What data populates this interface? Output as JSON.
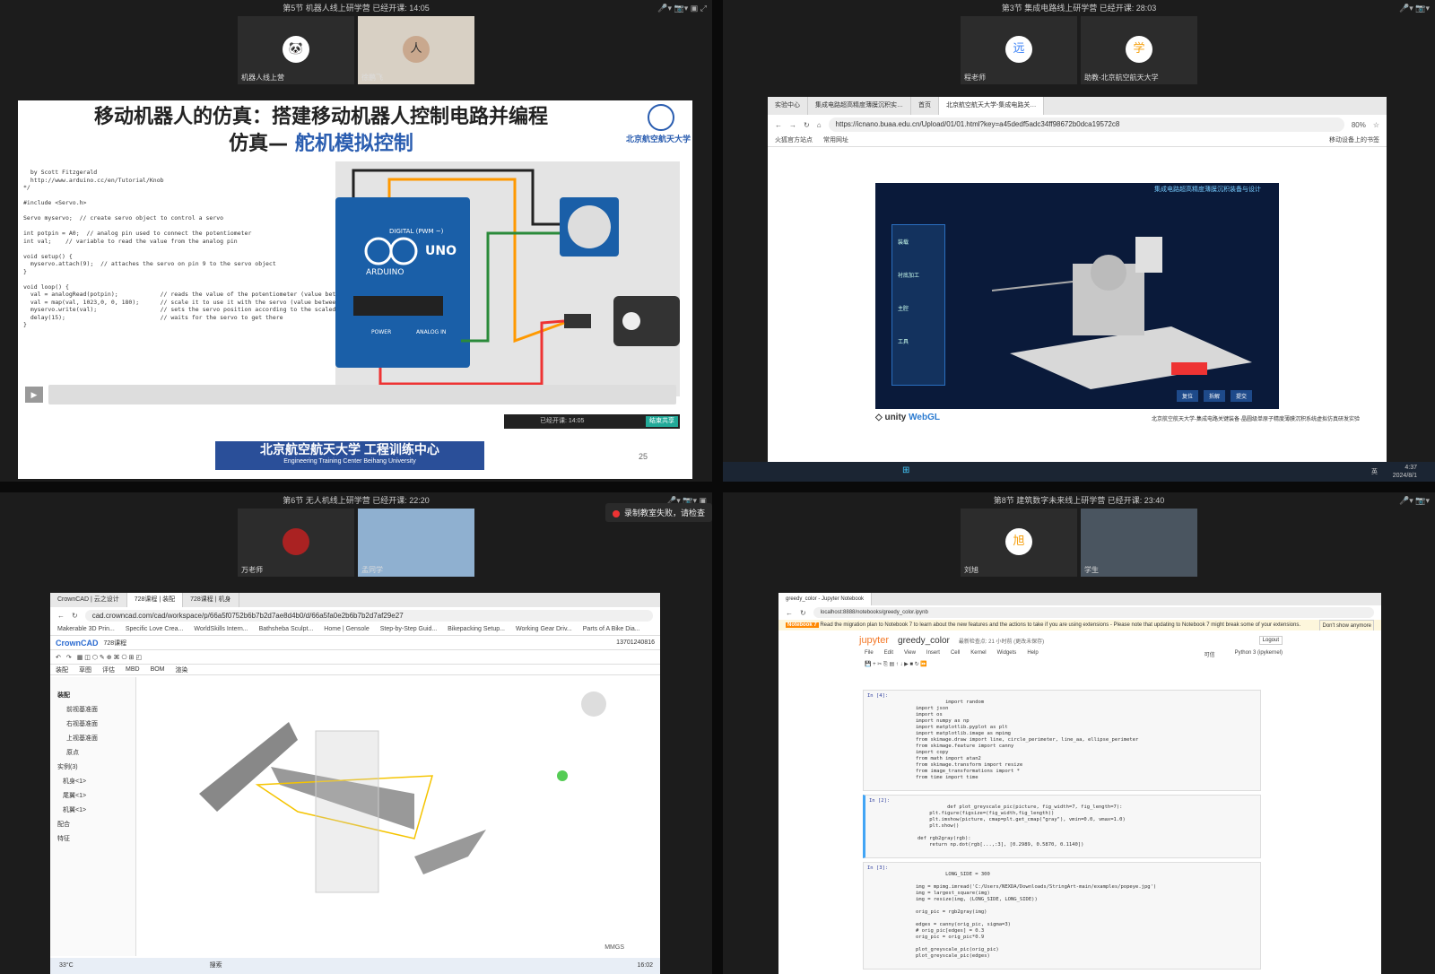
{
  "q1": {
    "topbar": "第5节 机器人线上研学营   已经开课: 14:05",
    "participants": [
      {
        "name": "机器人线上营",
        "avatar": "🐼"
      },
      {
        "name": "徐鹏飞",
        "avatar": "人"
      }
    ],
    "slide": {
      "title": "移动机器人的仿真：搭建移动机器人控制电路并编程",
      "subtitle_prefix": "仿真— ",
      "subtitle": "舵机模拟控制",
      "logo_text": "北京航空航天大学",
      "code": "  by Scott Fitzgerald\n  http://www.arduino.cc/en/Tutorial/Knob\n*/\n\n#include <Servo.h>\n\nServo myservo;  // create servo object to control a servo\n\nint potpin = A0;  // analog pin used to connect the potentiometer\nint val;    // variable to read the value from the analog pin\n\nvoid setup() {\n  myservo.attach(9);  // attaches the servo on pin 9 to the servo object\n}\n\nvoid loop() {\n  val = analogRead(potpin);            // reads the value of the potentiometer (value between 0 and\n  val = map(val, 1023,0, 0, 180);      // scale it to use it with the servo (value between 0 and 18\n  myservo.write(val);                  // sets the servo position according to the scaled value\n  delay(15);                           // waits for the servo to get there\n}",
      "board_label": "UNO",
      "board_brand": "ARDUINO",
      "digital_label": "DIGITAL (PWM ~)",
      "power_label": "POWER",
      "analog_label": "ANALOG IN",
      "footer_cn": "北京航空航天大学 工程训练中心",
      "footer_en": "Engineering Training Center Beihang University",
      "page": "25",
      "meet_time": "已经开课: 14:05",
      "meet_share": "结束共享"
    }
  },
  "q2": {
    "topbar": "第3节 集成电路线上研学营   已经开课: 28:03",
    "participants": [
      {
        "name": "程老师",
        "avatar": "远",
        "color": "#3b82f6"
      },
      {
        "name": "助教-北京航空航天大学",
        "avatar": "学",
        "color": "#f59e0b"
      }
    ],
    "tabs": [
      "实验中心",
      "集成电路超高精度薄膜沉积实…",
      "首页",
      "北京航空航天大学-集成电路关…"
    ],
    "url": "https://icnano.buaa.edu.cn/Upload/01/01.html?key=a45dedf5adc34ff98672b0dca19572c8",
    "zoom": "80%",
    "bookmarks": [
      "火狐官方站点",
      "常用网址"
    ],
    "bookmark_right": "移动设备上的书签",
    "unity_title": "集成电路超高精度薄膜沉积装备与设计",
    "unity_side": [
      "装载",
      "衬底加工",
      "主腔",
      "工具"
    ],
    "unity_btns": [
      "复位",
      "拆解",
      "提交"
    ],
    "unity_logo": "unity",
    "unity_logo2": "WebGL",
    "caption": "北京航空航天大学-集成电路关键装备·晶圆级单原子精度薄膜沉积系统虚拟仿真研发实验",
    "clock_time": "4:37",
    "clock_date": "2024/8/1",
    "tray_lang": "英"
  },
  "q3": {
    "topbar": "第6节 无人机线上研学营   已经开课: 22:20",
    "participants": [
      {
        "name": "万老师"
      },
      {
        "name": "孟同学"
      }
    ],
    "rec_fail": "录制教室失败，请检查",
    "tabs": [
      "CrownCAD | 云之设计",
      "728课程 | 装配",
      "728课程 | 机身"
    ],
    "url": "cad.crowncad.com/cad/workspace/p/66a5f0752b6b7b2d7ae8d4b0/d/66a5fa0e2b6b7b2d7af29e27",
    "bookmarks": [
      "Makerable 3D Prin...",
      "Specific Love Crea...",
      "WorldSkills Intern...",
      "Bathsheba Sculpt...",
      "Home | Gensole",
      "Step-by-Step Guid...",
      "Bikepacking Setup...",
      "Working Gear Driv...",
      "Parts of A Bike Dia..."
    ],
    "brand": "CrownCAD",
    "doc": "728课程",
    "phone": "13701240816",
    "menu": [
      "装配",
      "草图",
      "评估",
      "MBD",
      "BOM",
      "渲染"
    ],
    "tree_root": "装配",
    "tree": [
      "前视基准面",
      "右视基准面",
      "上视基准面",
      "原点"
    ],
    "instances_label": "实例(3)",
    "instances": [
      "机身<1>",
      "尾翼<1>",
      "机翼<1>"
    ],
    "mates": "配合",
    "features": "特征",
    "units": "MMGS",
    "search": "搜索",
    "weather": "33°C",
    "clock": "16:02"
  },
  "q4": {
    "topbar": "第8节 建筑数字未来线上研学营   已经开课: 23:40",
    "participants": [
      {
        "name": "刘旭",
        "avatar": "旭",
        "color": "#f59e0b"
      },
      {
        "name": "学生"
      }
    ],
    "tab": "greedy_color - Jupyter Notebook",
    "url": "localhost:8888/notebooks/greedy_color.ipynb",
    "notice_tag": "Notebook 7",
    "notice": "Read the migration plan to Notebook 7 to learn about the new features and the actions to take if you are using extensions - Please note that updating to Notebook 7 might break some of your extensions.",
    "notice_btn": "Don't show anymore",
    "brand": "jupyter",
    "nb_name": "greedy_color",
    "checkpoint": "最新检查点: 21 小时前 (更改未保存)",
    "logout": "Logout",
    "menu": [
      "File",
      "Edit",
      "View",
      "Insert",
      "Cell",
      "Kernel",
      "Widgets",
      "Help"
    ],
    "trusted": "可信",
    "kernel": "Python 3 (ipykernel)",
    "cells": [
      {
        "prompt": "In [4]:",
        "code": "import random\nimport json\nimport os\nimport numpy as np\nimport matplotlib.pyplot as plt\nimport matplotlib.image as mpimg\nfrom skimage.draw import line, circle_perimeter, line_aa, ellipse_perimeter\nfrom skimage.feature import canny\nimport copy\nfrom math import atan2\nfrom skimage.transform import resize\nfrom image_transformations import *\nfrom time import time"
      },
      {
        "prompt": "In [2]:",
        "code": "def plot_greyscale_pic(picture, fig_width=7, fig_length=7):\n    plt.figure(figsize=(fig_width,fig_length))\n    plt.imshow(picture, cmap=plt.get_cmap(\"gray\"), vmin=0.0, vmax=1.0)\n    plt.show()\n\ndef rgb2gray(rgb):\n    return np.dot(rgb[...,:3], [0.2989, 0.5870, 0.1140])"
      },
      {
        "prompt": "In [3]:",
        "code": "LONG_SIDE = 300\n\nimg = mpimg.imread('C:/Users/NEXDA/Downloads/StringArt-main/examples/popeye.jpg')\nimg = largest_square(img)\nimg = resize(img, (LONG_SIDE, LONG_SIDE))\n\norig_pic = rgb2gray(img)\n\nedges = canny(orig_pic, sigma=3)\n# orig_pic[edges] = 0.3\norig_pic = orig_pic*0.9\n\nplot_greyscale_pic(orig_pic)\nplot_greyscale_pic(edges)"
      }
    ]
  }
}
